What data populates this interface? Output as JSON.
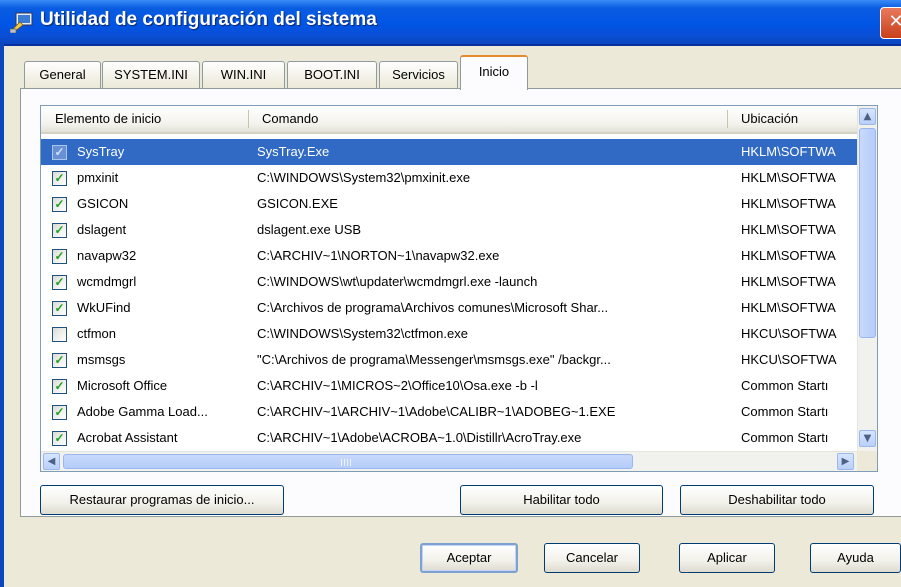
{
  "window": {
    "title": "Utilidad de configuración del sistema",
    "close_symbol": "✕"
  },
  "tabs": [
    {
      "label": "General"
    },
    {
      "label": "SYSTEM.INI"
    },
    {
      "label": "WIN.INI"
    },
    {
      "label": "BOOT.INI"
    },
    {
      "label": "Servicios"
    },
    {
      "label": "Inicio",
      "active": true
    }
  ],
  "list": {
    "columns": [
      "Elemento de inicio",
      "Comando",
      "Ubicación"
    ],
    "rows": [
      {
        "checked": true,
        "name": "SysTray",
        "command": "SysTray.Exe",
        "location": "HKLM\\SOFTWA",
        "selected": true
      },
      {
        "checked": true,
        "name": "pmxinit",
        "command": "C:\\WINDOWS\\System32\\pmxinit.exe",
        "location": "HKLM\\SOFTWA"
      },
      {
        "checked": true,
        "name": "GSICON",
        "command": "GSICON.EXE",
        "location": "HKLM\\SOFTWA"
      },
      {
        "checked": true,
        "name": "dslagent",
        "command": "dslagent.exe USB",
        "location": "HKLM\\SOFTWA"
      },
      {
        "checked": true,
        "name": "navapw32",
        "command": "C:\\ARCHIV~1\\NORTON~1\\navapw32.exe",
        "location": "HKLM\\SOFTWA"
      },
      {
        "checked": true,
        "name": "wcmdmgrl",
        "command": "C:\\WINDOWS\\wt\\updater\\wcmdmgrl.exe -launch",
        "location": "HKLM\\SOFTWA"
      },
      {
        "checked": true,
        "name": "WkUFind",
        "command": "C:\\Archivos de programa\\Archivos comunes\\Microsoft Shar...",
        "location": "HKLM\\SOFTWA"
      },
      {
        "checked": false,
        "name": "ctfmon",
        "command": "C:\\WINDOWS\\System32\\ctfmon.exe",
        "location": "HKCU\\SOFTWA"
      },
      {
        "checked": true,
        "name": "msmsgs",
        "command": "\"C:\\Archivos de programa\\Messenger\\msmsgs.exe\" /backgr...",
        "location": "HKCU\\SOFTWA"
      },
      {
        "checked": true,
        "name": "Microsoft Office",
        "command": "C:\\ARCHIV~1\\MICROS~2\\Office10\\Osa.exe -b -l",
        "location": "Common Startı"
      },
      {
        "checked": true,
        "name": "Adobe Gamma Load...",
        "command": "C:\\ARCHIV~1\\ARCHIV~1\\Adobe\\CALIBR~1\\ADOBEG~1.EXE",
        "location": "Common Startı"
      },
      {
        "checked": true,
        "name": "Acrobat Assistant",
        "command": "C:\\ARCHIV~1\\Adobe\\ACROBA~1.0\\Distillr\\AcroTray.exe",
        "location": "Common Startı"
      }
    ]
  },
  "buttons": {
    "restore": "Restaurar programas de inicio...",
    "enable_all": "Habilitar todo",
    "disable_all": "Deshabilitar todo",
    "ok": "Aceptar",
    "cancel": "Cancelar",
    "apply": "Aplicar",
    "help": "Ayuda"
  },
  "icons": {
    "check": "✓",
    "arrow_up": "▲",
    "arrow_down": "▼",
    "arrow_left": "◀",
    "arrow_right": "▶"
  },
  "colors": {
    "title_bar": "#0055e5",
    "selection": "#316ac5",
    "active_tab_accent": "#e68b2c",
    "dialog_bg": "#ece9d8"
  }
}
